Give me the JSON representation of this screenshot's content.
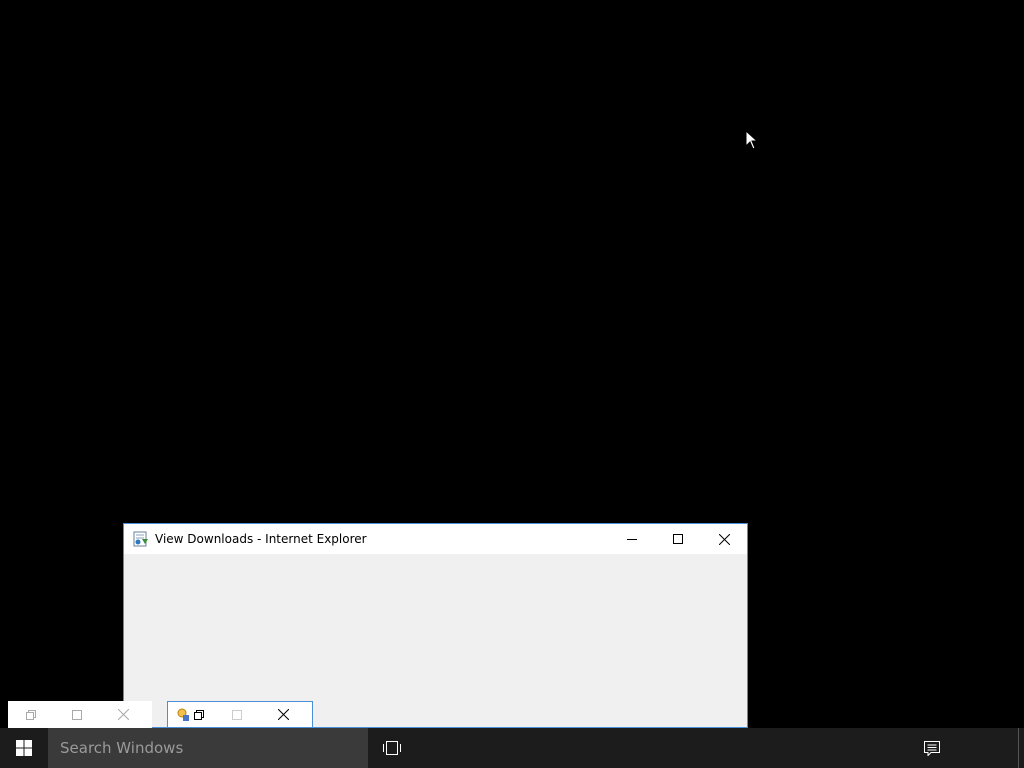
{
  "window": {
    "title": "View Downloads - Internet Explorer",
    "border_color": "#4a90d9",
    "icons": {
      "app": "ie-downloads-icon",
      "minimize": "minimize-icon",
      "maximize": "maximize-icon",
      "close": "close-icon"
    }
  },
  "minimized_windows": [
    {
      "icons": [
        "restore-icon",
        "maximize-icon",
        "close-icon"
      ]
    },
    {
      "icons": [
        "app-icon",
        "restore-icon",
        "maximize-icon",
        "close-icon"
      ]
    }
  ],
  "taskbar": {
    "search_placeholder": "Search Windows",
    "background": "#1c1c1c",
    "icons": {
      "start": "windows-logo-icon",
      "task_view": "task-view-icon",
      "notifications": "action-center-icon"
    }
  }
}
